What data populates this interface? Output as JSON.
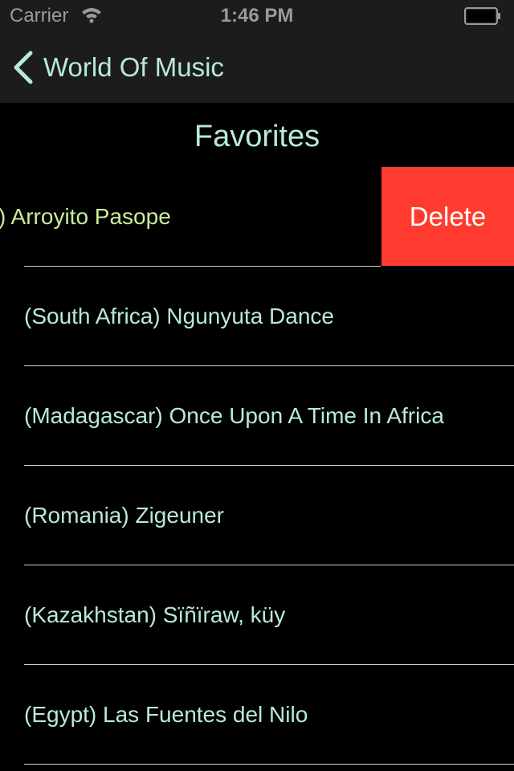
{
  "status_bar": {
    "carrier": "Carrier",
    "time": "1:46 PM"
  },
  "nav": {
    "back_label": "World Of Music"
  },
  "section": {
    "title": "Favorites"
  },
  "rows": [
    {
      "label": ") Arroyito Pasope",
      "swiped": true
    },
    {
      "label": "(South Africa) Ngunyuta Dance"
    },
    {
      "label": "(Madagascar) Once Upon A Time In Africa"
    },
    {
      "label": "(Romania) Zigeuner"
    },
    {
      "label": "(Kazakhstan) Sïñïraw, küy"
    },
    {
      "label": "(Egypt) Las Fuentes del Nilo"
    }
  ],
  "delete_label": "Delete",
  "colors": {
    "accent": "#b8ead7",
    "swiped_text": "#c9ec9a",
    "delete_bg": "#ff3b30",
    "bar_bg": "#1c1c1c",
    "background": "#000000"
  }
}
